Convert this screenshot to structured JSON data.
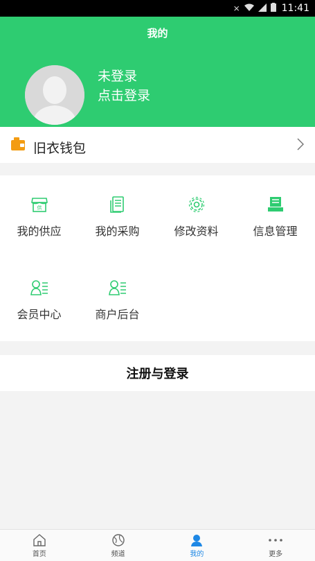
{
  "status_bar": {
    "time": "11:41"
  },
  "header": {
    "title": "我的",
    "login_status": "未登录",
    "login_prompt": "点击登录",
    "color": "#2ecc71"
  },
  "wallet": {
    "label": "旧衣钱包",
    "icon": "wallet-icon"
  },
  "menu": {
    "items": [
      {
        "label": "我的供应",
        "icon": "supply-icon"
      },
      {
        "label": "我的采购",
        "icon": "purchase-icon"
      },
      {
        "label": "修改资料",
        "icon": "gear-icon"
      },
      {
        "label": "信息管理",
        "icon": "info-manage-icon"
      },
      {
        "label": "会员中心",
        "icon": "member-icon"
      },
      {
        "label": "商户后台",
        "icon": "merchant-icon"
      }
    ]
  },
  "register": {
    "label": "注册与登录"
  },
  "tabbar": {
    "items": [
      {
        "label": "首页",
        "icon": "home-icon"
      },
      {
        "label": "频道",
        "icon": "globe-icon"
      },
      {
        "label": "我的",
        "icon": "person-icon",
        "active": true
      },
      {
        "label": "更多",
        "icon": "more-icon"
      }
    ],
    "active_color": "#1e88e5"
  }
}
